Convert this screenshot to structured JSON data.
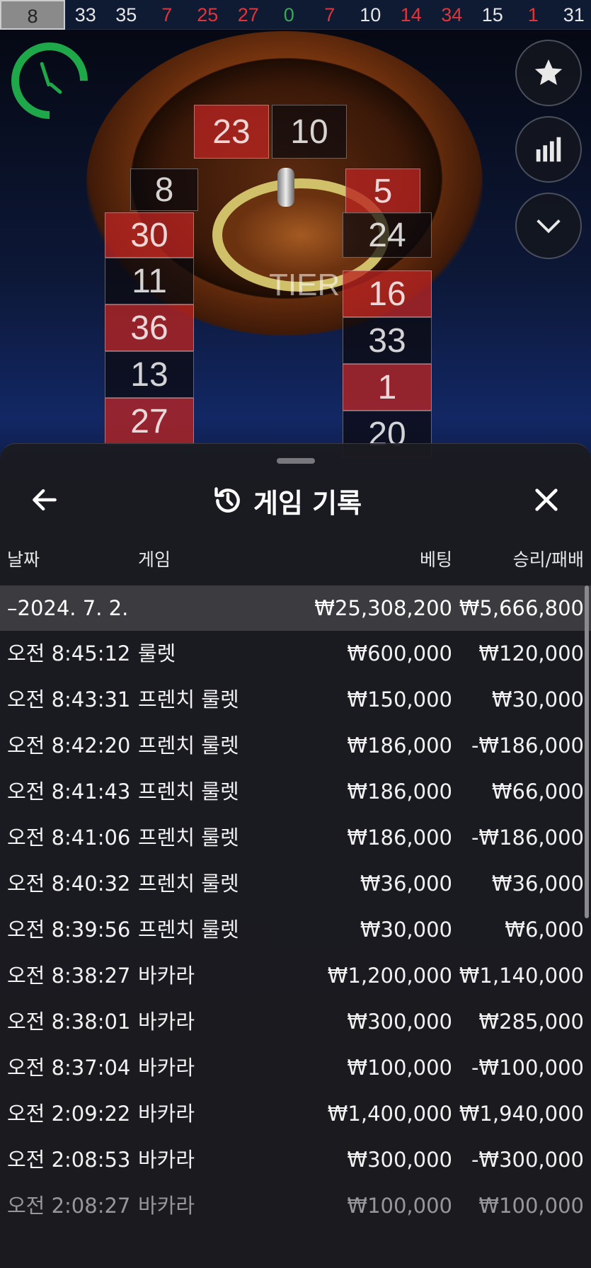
{
  "recent_results": [
    {
      "n": "8",
      "color": "highlight"
    },
    {
      "n": "33",
      "color": "black"
    },
    {
      "n": "35",
      "color": "black"
    },
    {
      "n": "7",
      "color": "red"
    },
    {
      "n": "25",
      "color": "red"
    },
    {
      "n": "27",
      "color": "red"
    },
    {
      "n": "0",
      "color": "green"
    },
    {
      "n": "7",
      "color": "red"
    },
    {
      "n": "10",
      "color": "black"
    },
    {
      "n": "14",
      "color": "red"
    },
    {
      "n": "34",
      "color": "red"
    },
    {
      "n": "15",
      "color": "black"
    },
    {
      "n": "1",
      "color": "red"
    },
    {
      "n": "31",
      "color": "black"
    }
  ],
  "racetrack": {
    "tier_label": "TIER",
    "cells": [
      {
        "n": "23",
        "color": "red"
      },
      {
        "n": "10",
        "color": "black"
      },
      {
        "n": "8",
        "color": "black"
      },
      {
        "n": "5",
        "color": "red"
      },
      {
        "n": "30",
        "color": "red"
      },
      {
        "n": "24",
        "color": "black"
      },
      {
        "n": "11",
        "color": "black"
      },
      {
        "n": "16",
        "color": "red"
      },
      {
        "n": "36",
        "color": "red"
      },
      {
        "n": "33",
        "color": "black"
      },
      {
        "n": "13",
        "color": "black"
      },
      {
        "n": "1",
        "color": "red"
      },
      {
        "n": "27",
        "color": "red"
      },
      {
        "n": "20",
        "color": "black"
      }
    ]
  },
  "side_buttons": {
    "favorites_icon": "star-icon",
    "stats_icon": "stats-icon",
    "collapse_icon": "chevron-down-icon"
  },
  "sheet": {
    "title": "게임 기록",
    "columns": {
      "date": "날짜",
      "game": "게임",
      "bet": "베팅",
      "result": "승리/패배"
    },
    "date_group": {
      "date": "–2024. 7. 2.",
      "total_bet": "₩25,308,200",
      "total_result": "₩5,666,800"
    },
    "rows": [
      {
        "time": "오전 8:45:12",
        "game": "룰렛",
        "bet": "₩600,000",
        "result": "₩120,000"
      },
      {
        "time": "오전 8:43:31",
        "game": "프렌치 룰렛",
        "bet": "₩150,000",
        "result": "₩30,000"
      },
      {
        "time": "오전 8:42:20",
        "game": "프렌치 룰렛",
        "bet": "₩186,000",
        "result": "-₩186,000"
      },
      {
        "time": "오전 8:41:43",
        "game": "프렌치 룰렛",
        "bet": "₩186,000",
        "result": "₩66,000"
      },
      {
        "time": "오전 8:41:06",
        "game": "프렌치 룰렛",
        "bet": "₩186,000",
        "result": "-₩186,000"
      },
      {
        "time": "오전 8:40:32",
        "game": "프렌치 룰렛",
        "bet": "₩36,000",
        "result": "₩36,000"
      },
      {
        "time": "오전 8:39:56",
        "game": "프렌치 룰렛",
        "bet": "₩30,000",
        "result": "₩6,000"
      },
      {
        "time": "오전 8:38:27",
        "game": "바카라",
        "bet": "₩1,200,000",
        "result": "₩1,140,000"
      },
      {
        "time": "오전 8:38:01",
        "game": "바카라",
        "bet": "₩300,000",
        "result": "₩285,000"
      },
      {
        "time": "오전 8:37:04",
        "game": "바카라",
        "bet": "₩100,000",
        "result": "-₩100,000"
      },
      {
        "time": "오전 2:09:22",
        "game": "바카라",
        "bet": "₩1,400,000",
        "result": "₩1,940,000"
      },
      {
        "time": "오전 2:08:53",
        "game": "바카라",
        "bet": "₩300,000",
        "result": "-₩300,000"
      },
      {
        "time": "오전 2:08:27",
        "game": "바카라",
        "bet": "₩100,000",
        "result": "₩100,000"
      }
    ]
  }
}
